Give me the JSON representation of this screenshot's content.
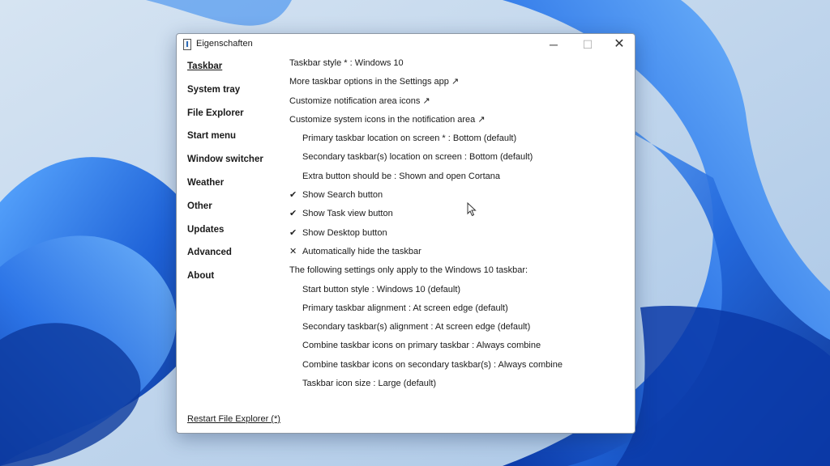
{
  "window": {
    "title": "Eigenschaften",
    "minimize_glyph": "─",
    "maximize_glyph": "☐",
    "close_glyph": "✕"
  },
  "nav": {
    "items": [
      {
        "label": "Taskbar",
        "active": true
      },
      {
        "label": "System tray"
      },
      {
        "label": "File Explorer"
      },
      {
        "label": "Start menu"
      },
      {
        "label": "Window switcher"
      },
      {
        "label": "Weather"
      },
      {
        "label": "Other"
      },
      {
        "label": "Updates"
      },
      {
        "label": "Advanced"
      },
      {
        "label": "About"
      }
    ]
  },
  "settings": [
    {
      "text": "Taskbar style * : Windows 10",
      "mark": ""
    },
    {
      "text": "More taskbar options in the Settings app ↗",
      "mark": ""
    },
    {
      "text": "Customize notification area icons ↗",
      "mark": ""
    },
    {
      "text": "Customize system icons in the notification area ↗",
      "mark": ""
    },
    {
      "text": "Primary taskbar location on screen * : Bottom (default)",
      "mark": "",
      "indent": true
    },
    {
      "text": "Secondary taskbar(s) location on screen : Bottom (default)",
      "mark": "",
      "indent": true
    },
    {
      "text": "Extra button should be : Shown and open Cortana",
      "mark": "",
      "indent": true
    },
    {
      "text": "Show Search button",
      "mark": "✔",
      "indent": true
    },
    {
      "text": "Show Task view button",
      "mark": "✔",
      "indent": true
    },
    {
      "text": "Show Desktop button",
      "mark": "✔",
      "indent": true
    },
    {
      "text": "Automatically hide the taskbar",
      "mark": "✕",
      "indent": true
    },
    {
      "text": "The following settings only apply to the Windows 10 taskbar:",
      "mark": ""
    },
    {
      "text": "Start button style : Windows 10 (default)",
      "mark": "",
      "indent": true
    },
    {
      "text": "Primary taskbar alignment : At screen edge (default)",
      "mark": "",
      "indent": true
    },
    {
      "text": "Secondary taskbar(s) alignment : At screen edge (default)",
      "mark": "",
      "indent": true
    },
    {
      "text": "Combine taskbar icons on primary taskbar : Always combine",
      "mark": "",
      "indent": true
    },
    {
      "text": "Combine taskbar icons on secondary taskbar(s) : Always combine",
      "mark": "",
      "indent": true
    },
    {
      "text": "Taskbar icon size : Large (default)",
      "mark": "",
      "indent": true
    }
  ],
  "footer": {
    "restart_label": "Restart File Explorer (*)"
  },
  "colors": {
    "wallpaper_bg": "#bcd3ea",
    "bloom_blue": "#1f63d8"
  }
}
